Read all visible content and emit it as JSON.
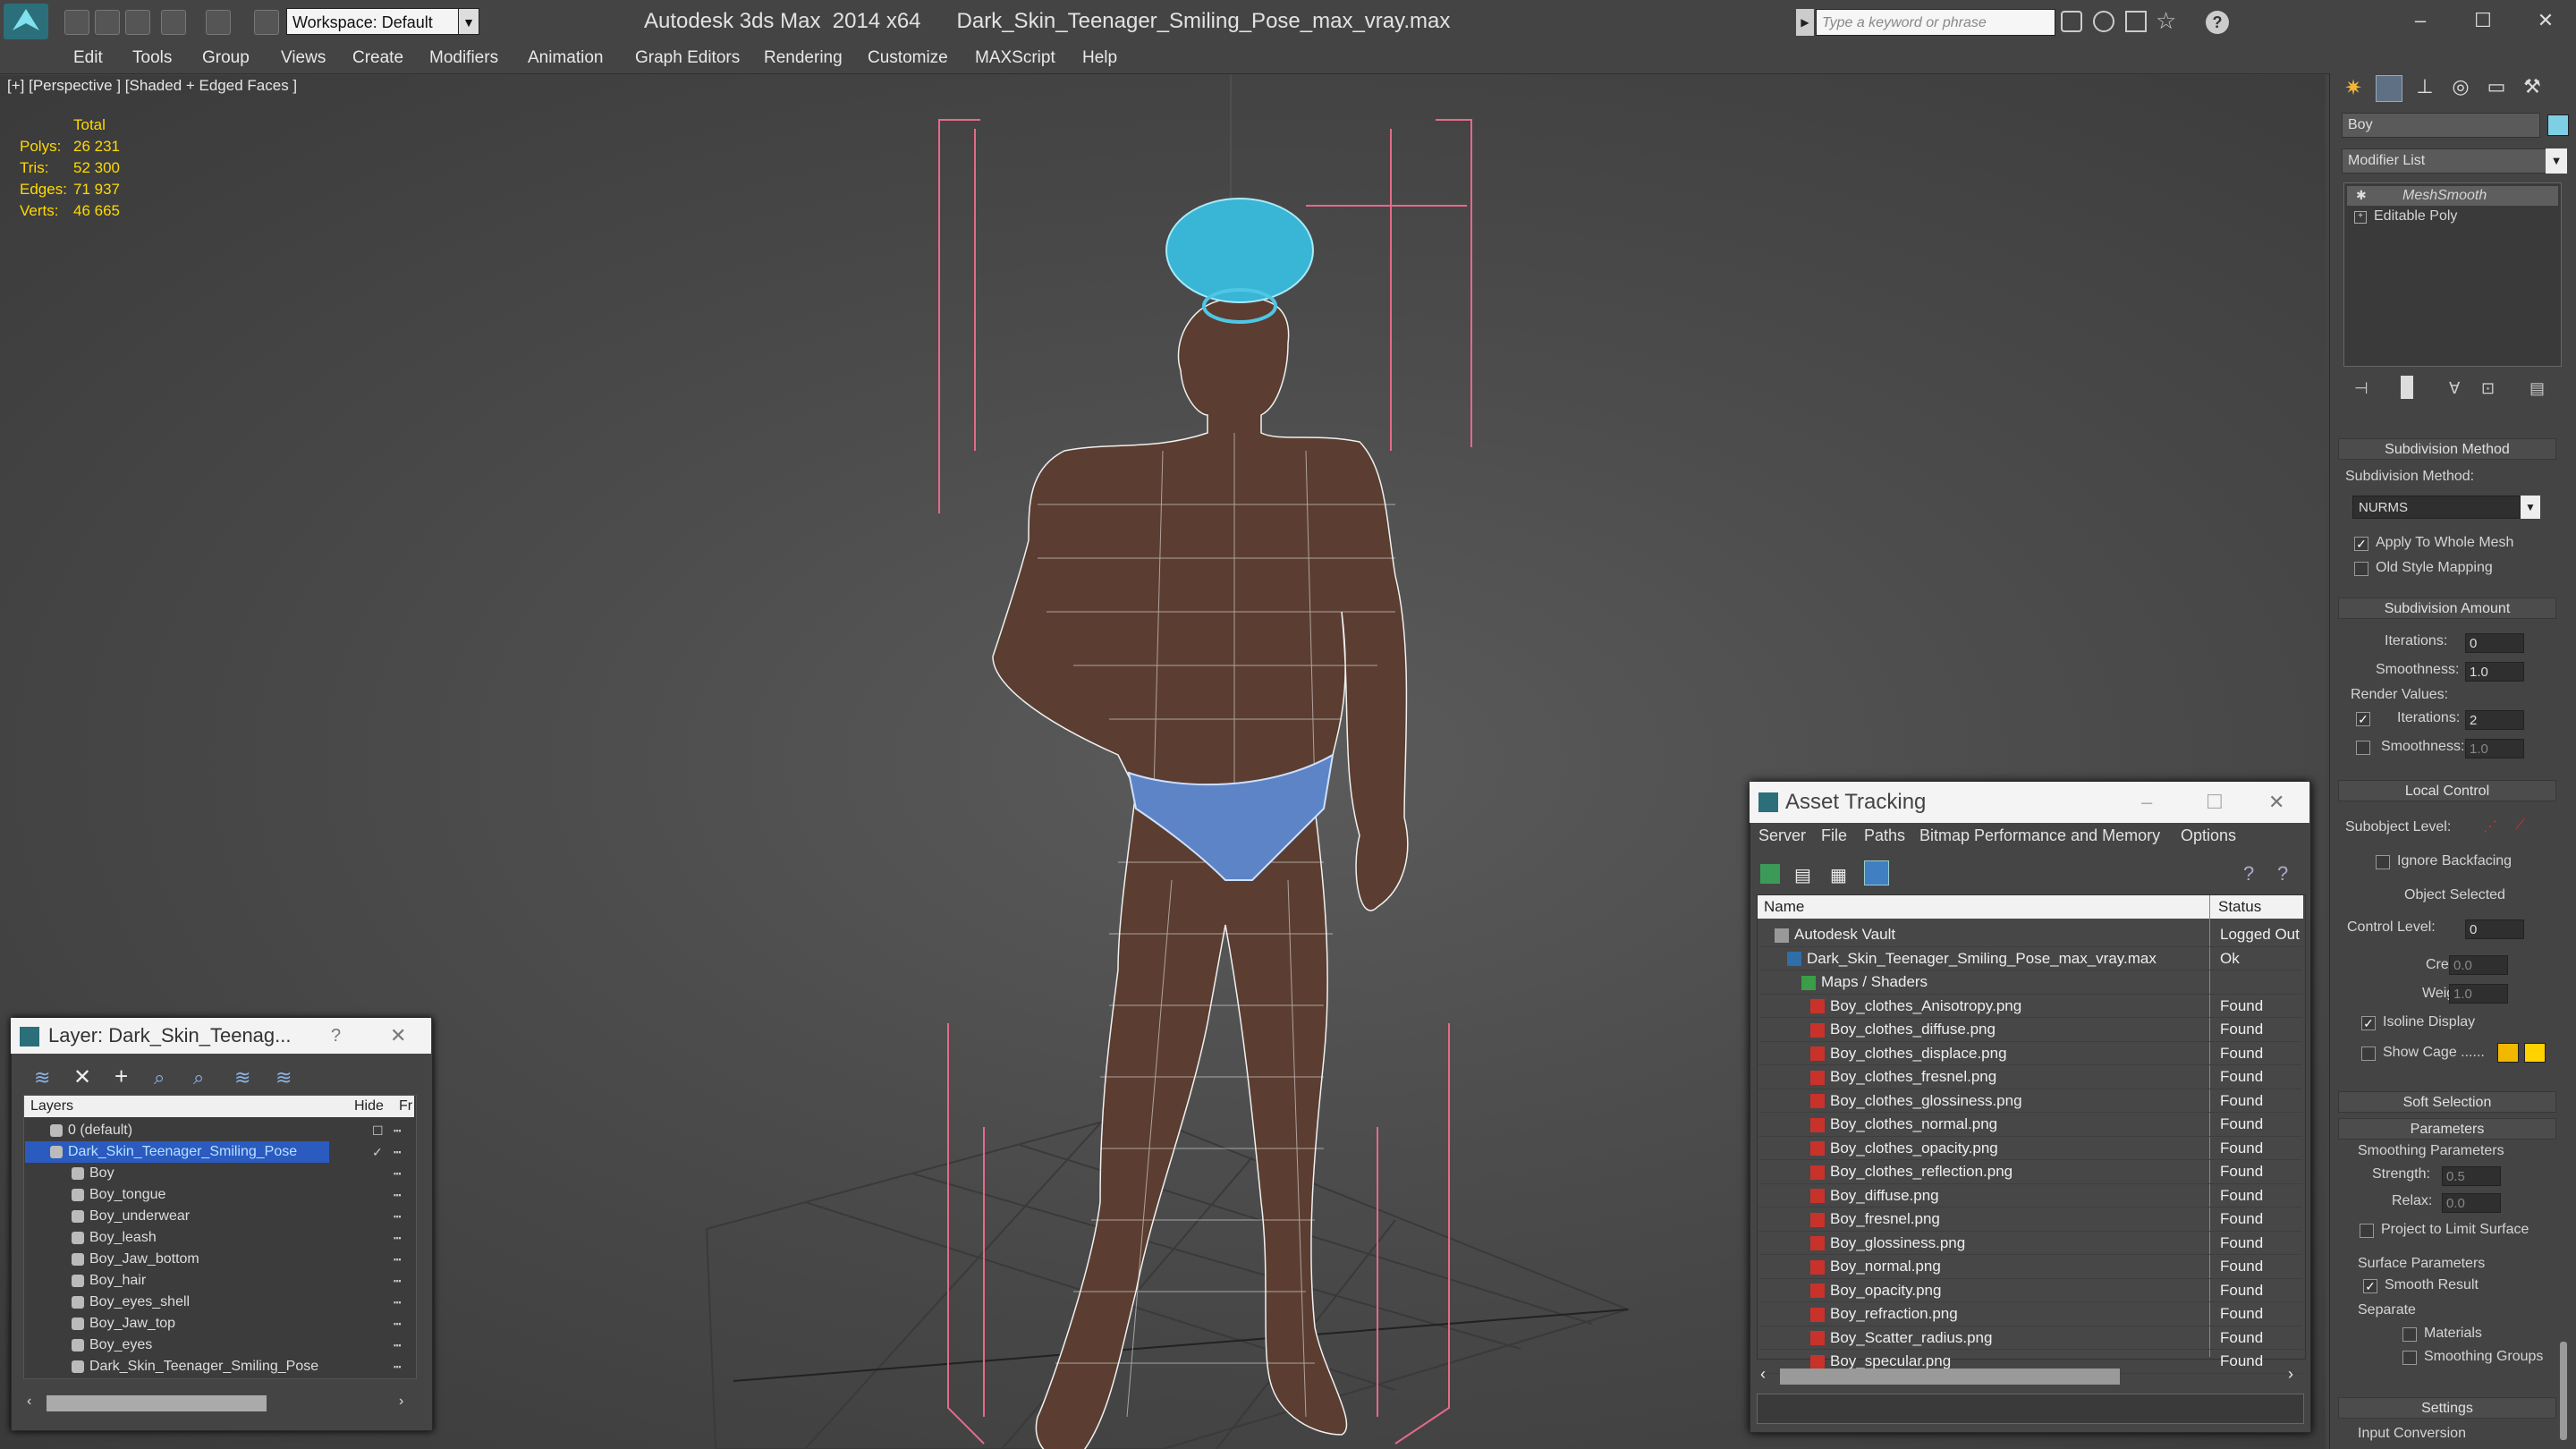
{
  "titlebar": {
    "title": "Autodesk 3ds Max  2014 x64      Dark_Skin_Teenager_Smiling_Pose_max_vray.max",
    "workspace": "Workspace: Default",
    "search_placeholder": "Type a keyword or phrase"
  },
  "menu": [
    "Edit",
    "Tools",
    "Group",
    "Views",
    "Create",
    "Modifiers",
    "Animation",
    "Graph Editors",
    "Rendering",
    "Customize",
    "MAXScript",
    "Help"
  ],
  "viewport": {
    "label": "[+] [Perspective ] [Shaded + Edged Faces ]",
    "stats": {
      "header": "Total",
      "rows": [
        {
          "label": "Polys:",
          "value": "26 231"
        },
        {
          "label": "Tris:",
          "value": "52 300"
        },
        {
          "label": "Edges:",
          "value": "71 937"
        },
        {
          "label": "Verts:",
          "value": "46 665"
        }
      ]
    }
  },
  "command_panel": {
    "object_name": "Boy",
    "object_color": "#7ecfe6",
    "modifier_list_label": "Modifier List",
    "stack": [
      "MeshSmooth",
      "Editable Poly"
    ],
    "subdivision_method": {
      "rollout": "Subdivision Method",
      "label": "Subdivision Method:",
      "value": "NURMS",
      "apply_whole_mesh": "Apply To Whole Mesh",
      "old_style": "Old Style Mapping"
    },
    "subdivision_amount": {
      "rollout": "Subdivision Amount",
      "iterations_label": "Iterations:",
      "iterations": "0",
      "smoothness_label": "Smoothness:",
      "smoothness": "1.0",
      "render_values": "Render Values:",
      "r_iterations_label": "Iterations:",
      "r_iterations": "2",
      "r_smoothness_label": "Smoothness:",
      "r_smoothness": "1.0"
    },
    "local_control": {
      "rollout": "Local Control",
      "subobject": "Subobject Level:",
      "ignore_backfacing": "Ignore Backfacing",
      "object_selected": "Object Selected",
      "control_level_label": "Control Level:",
      "control_level": "0",
      "crease_label": "Crease:",
      "crease": "0.0",
      "weight_label": "Weight:",
      "weight": "1.0",
      "isoline": "Isoline Display",
      "show_cage": "Show Cage ......",
      "cage_color1": "#f2b800",
      "cage_color2": "#ffd200"
    },
    "soft_selection": "Soft Selection",
    "parameters": {
      "rollout": "Parameters",
      "smoothing": "Smoothing Parameters",
      "strength_label": "Strength:",
      "strength": "0.5",
      "relax_label": "Relax:",
      "relax": "0.0",
      "project": "Project to Limit Surface",
      "surface": "Surface Parameters",
      "smooth_result": "Smooth Result",
      "separate": "Separate",
      "materials": "Materials",
      "smoothing_groups": "Smoothing Groups"
    },
    "settings": "Settings",
    "input_conversion": "Input Conversion"
  },
  "layer_window": {
    "title": "Layer: Dark_Skin_Teenag...",
    "help": "?",
    "col_layers": "Layers",
    "col_hide": "Hide",
    "col_fr": "Fr",
    "rows": [
      {
        "name": "0 (default)",
        "level": 1,
        "selected": false
      },
      {
        "name": "Dark_Skin_Teenager_Smiling_Pose",
        "level": 1,
        "selected": true
      },
      {
        "name": "Boy",
        "level": 2,
        "selected": false
      },
      {
        "name": "Boy_tongue",
        "level": 2,
        "selected": false
      },
      {
        "name": "Boy_underwear",
        "level": 2,
        "selected": false
      },
      {
        "name": "Boy_leash",
        "level": 2,
        "selected": false
      },
      {
        "name": "Boy_Jaw_bottom",
        "level": 2,
        "selected": false
      },
      {
        "name": "Boy_hair",
        "level": 2,
        "selected": false
      },
      {
        "name": "Boy_eyes_shell",
        "level": 2,
        "selected": false
      },
      {
        "name": "Boy_Jaw_top",
        "level": 2,
        "selected": false
      },
      {
        "name": "Boy_eyes",
        "level": 2,
        "selected": false
      },
      {
        "name": "Dark_Skin_Teenager_Smiling_Pose",
        "level": 2,
        "selected": false
      }
    ]
  },
  "asset_window": {
    "title": "Asset Tracking",
    "menu": [
      "Server",
      "File",
      "Paths",
      "Bitmap Performance and Memory",
      "Options"
    ],
    "col_name": "Name",
    "col_status": "Status",
    "rows": [
      {
        "name": "Autodesk Vault",
        "status": "Logged Out",
        "level": 1
      },
      {
        "name": "Dark_Skin_Teenager_Smiling_Pose_max_vray.max",
        "status": "Ok",
        "level": 2
      },
      {
        "name": "Maps / Shaders",
        "status": "",
        "level": 3
      },
      {
        "name": "Boy_clothes_Anisotropy.png",
        "status": "Found",
        "level": 4
      },
      {
        "name": "Boy_clothes_diffuse.png",
        "status": "Found",
        "level": 4
      },
      {
        "name": "Boy_clothes_displace.png",
        "status": "Found",
        "level": 4
      },
      {
        "name": "Boy_clothes_fresnel.png",
        "status": "Found",
        "level": 4
      },
      {
        "name": "Boy_clothes_glossiness.png",
        "status": "Found",
        "level": 4
      },
      {
        "name": "Boy_clothes_normal.png",
        "status": "Found",
        "level": 4
      },
      {
        "name": "Boy_clothes_opacity.png",
        "status": "Found",
        "level": 4
      },
      {
        "name": "Boy_clothes_reflection.png",
        "status": "Found",
        "level": 4
      },
      {
        "name": "Boy_diffuse.png",
        "status": "Found",
        "level": 4
      },
      {
        "name": "Boy_fresnel.png",
        "status": "Found",
        "level": 4
      },
      {
        "name": "Boy_glossiness.png",
        "status": "Found",
        "level": 4
      },
      {
        "name": "Boy_normal.png",
        "status": "Found",
        "level": 4
      },
      {
        "name": "Boy_opacity.png",
        "status": "Found",
        "level": 4
      },
      {
        "name": "Boy_refraction.png",
        "status": "Found",
        "level": 4
      },
      {
        "name": "Boy_Scatter_radius.png",
        "status": "Found",
        "level": 4
      },
      {
        "name": "Boy_specular.png",
        "status": "Found",
        "level": 4
      }
    ]
  }
}
